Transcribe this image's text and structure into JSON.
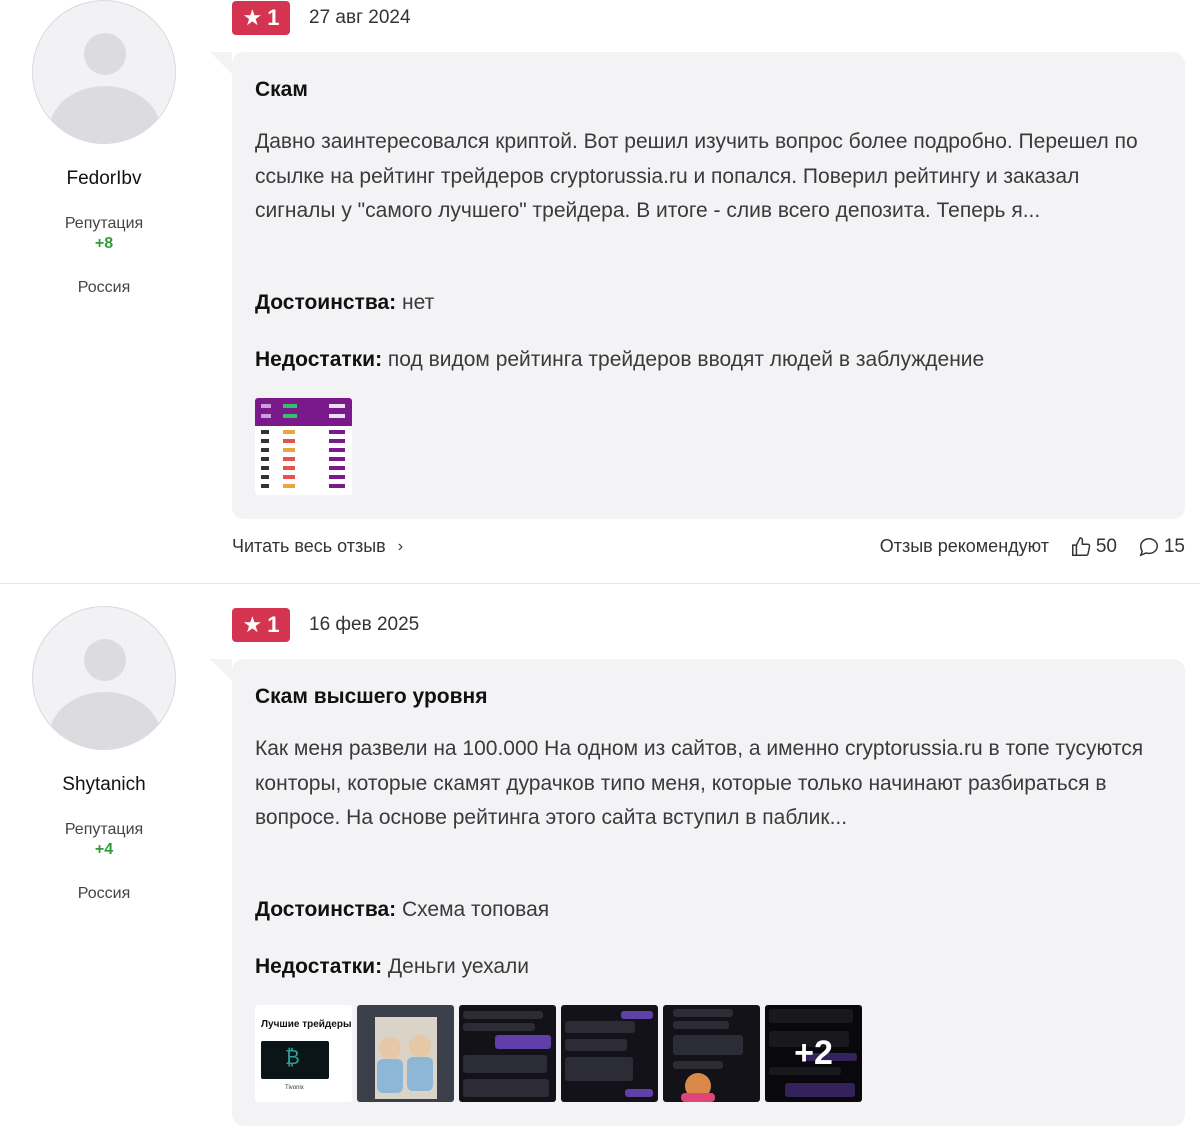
{
  "reviews": [
    {
      "author": {
        "name": "FedorIbv",
        "reputation_label": "Репутация",
        "reputation_value": "+8",
        "country": "Россия"
      },
      "rating": "1",
      "date": "27 авг 2024",
      "title": "Скам",
      "text": "Давно заинтересовался криптой. Вот решил изучить вопрос более подробно. Перешел по ссылке на рейтинг трейдеров cryptorussia.ru и попался. Поверил рейтингу и заказал сигналы у \"самого лучшего\" трейдера. В итоге - слив всего депозита. Теперь я...",
      "pros_label": "Достоинства:",
      "pros": "нет",
      "cons_label": "Недостатки:",
      "cons": "под видом рейтинга трейдеров вводят людей в заблуждение",
      "read_more": "Читать весь отзыв",
      "recommend_label": "Отзыв рекомендуют",
      "likes": "50",
      "comments": "15"
    },
    {
      "author": {
        "name": "Shytanich",
        "reputation_label": "Репутация",
        "reputation_value": "+4",
        "country": "Россия"
      },
      "rating": "1",
      "date": "16 фев 2025",
      "title": "Скам высшего уровня",
      "text": "Как меня развели на 100.000 На одном из сайтов, а именно cryptorussia.ru в топе тусуются конторы, которые скамят дурачков типо меня, которые только начинают разбираться в вопросе. На основе рейтинга этого сайта вступил в паблик...",
      "pros_label": "Достоинства:",
      "pros": "Схема топовая",
      "cons_label": "Недостатки:",
      "cons": "Деньги уехали",
      "thumb_title": "Лучшие трейдеры",
      "thumb_caption": "Tivonix",
      "more_photos": "+2"
    }
  ],
  "colors": {
    "badge": "#d4344f",
    "card_bg": "#f3f3f5",
    "reputation": "#2e9e3a"
  },
  "icons": [
    "star-icon",
    "chevron-right-icon",
    "thumbs-up-icon",
    "comment-icon"
  ]
}
